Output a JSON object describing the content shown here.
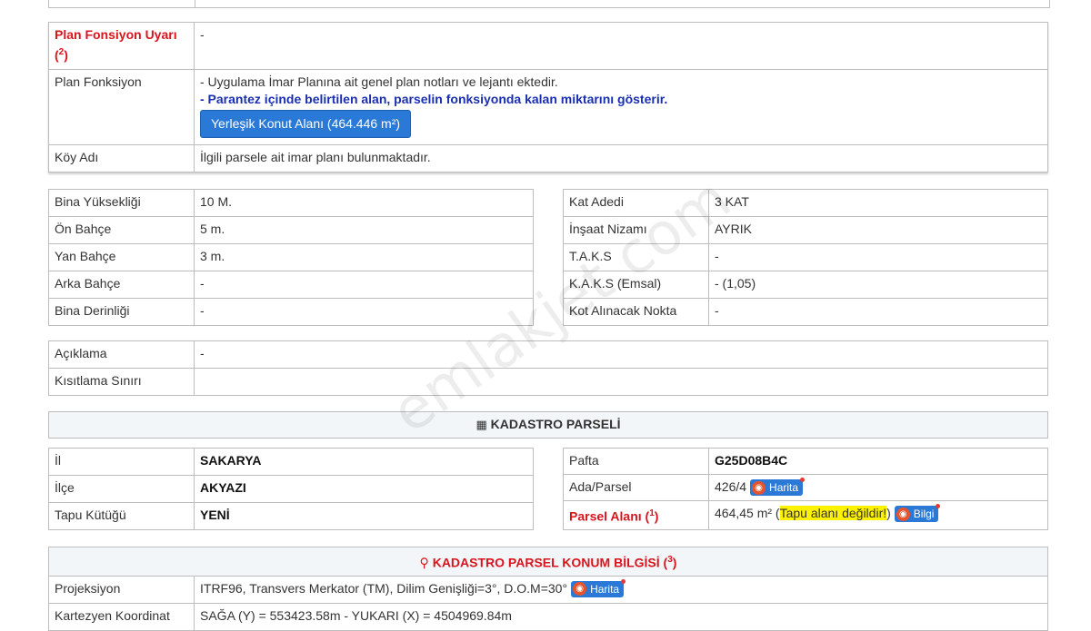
{
  "plan": {
    "warning_label": "Plan Fonsiyon Uyarı (",
    "warning_sup": "2",
    "warning_close": ")",
    "warning_value": "-",
    "function_label": "Plan Fonksiyon",
    "function_note1": "- Uygulama İmar Planına ait genel plan notları ve lejantı ektedir.",
    "function_note2": "- Parantez içinde belirtilen alan, parselin fonksiyonda kalan miktarını gösterir.",
    "function_button": "Yerleşik Konut Alanı (464.446 m²)",
    "village_label": "Köy Adı",
    "village_value": "İlgili parsele ait imar planı bulunmaktadır."
  },
  "building_left": [
    {
      "label": "Bina Yüksekliği",
      "value": "10 M."
    },
    {
      "label": "Ön Bahçe",
      "value": "5 m."
    },
    {
      "label": "Yan Bahçe",
      "value": "3 m."
    },
    {
      "label": "Arka Bahçe",
      "value": "-"
    },
    {
      "label": "Bina Derinliği",
      "value": "-"
    }
  ],
  "building_right": [
    {
      "label": "Kat Adedi",
      "value": "3 KAT"
    },
    {
      "label": "İnşaat Nizamı",
      "value": "AYRIK"
    },
    {
      "label": "T.A.K.S",
      "value": "-"
    },
    {
      "label": "K.A.K.S (Emsal)",
      "value": "- (1,05)"
    },
    {
      "label": "Kot Alınacak Nokta",
      "value": "-"
    }
  ],
  "notes": [
    {
      "label": "Açıklama",
      "value": "-"
    },
    {
      "label": "Kısıtlama Sınırı",
      "value": ""
    }
  ],
  "cadastre": {
    "header": "KADASTRO PARSELİ",
    "left": [
      {
        "label": "İl",
        "value": "SAKARYA"
      },
      {
        "label": "İlçe",
        "value": "AKYAZI"
      },
      {
        "label": "Tapu Kütüğü",
        "value": "YENİ"
      }
    ],
    "pafta_label": "Pafta",
    "pafta_value": "G25D08B4C",
    "ada_label": "Ada/Parsel",
    "ada_value": "426/4",
    "map_badge": "Harita",
    "area_label": "Parsel Alanı (",
    "area_sup": "1",
    "area_close": ")",
    "area_value": "464,45 m² (",
    "area_highlight": "Tapu alanı değildir!",
    "area_value_close": ")",
    "info_badge": "Bilgi"
  },
  "location": {
    "header": "KADASTRO PARSEL KONUM BİLGİSİ (",
    "header_sup": "3",
    "header_close": ")",
    "projection_label": "Projeksiyon",
    "projection_value": "ITRF96, Transvers Merkator (TM), Dilim Genişliği=3°, D.O.M=30°",
    "map_badge": "Harita",
    "coord_label": "Kartezyen Koordinat",
    "coord_value": "SAĞA (Y) = 553423.58m - YUKARI (X) = 4504969.84m"
  },
  "watermark": "emlakjet.com"
}
